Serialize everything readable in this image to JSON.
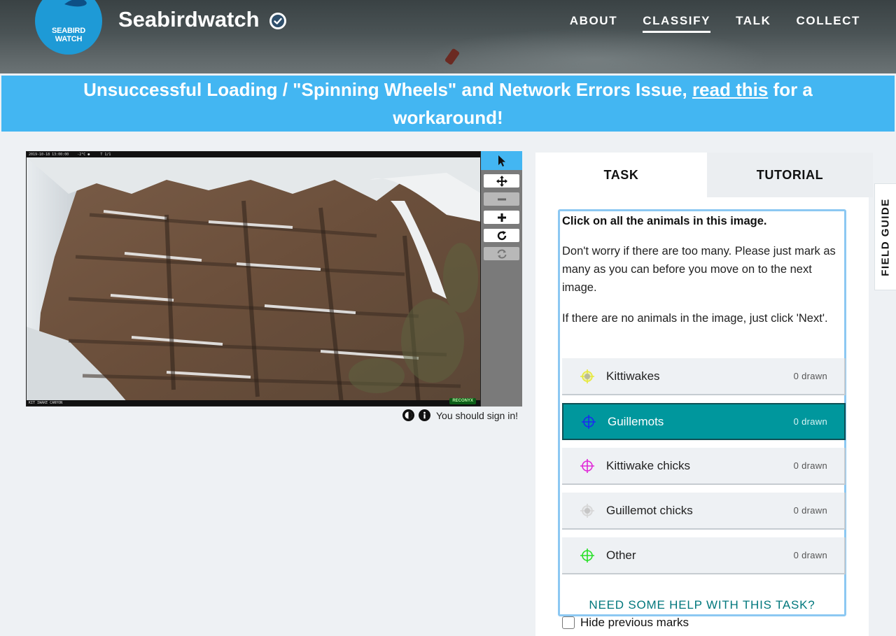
{
  "header": {
    "logo_text_line1": "SEABIRD",
    "logo_text_line2": "WATCH",
    "project_title": "Seabirdwatch",
    "nav": [
      {
        "label": "ABOUT",
        "active": false
      },
      {
        "label": "CLASSIFY",
        "active": true
      },
      {
        "label": "TALK",
        "active": false
      },
      {
        "label": "COLLECT",
        "active": false
      }
    ]
  },
  "banner": {
    "text_before": "Unsuccessful Loading / \"Spinning Wheels\" and Network Errors Issue, ",
    "link_text": "read this",
    "text_after": " for a workaround!"
  },
  "viewer": {
    "camera_top_text": "2019-10-18 13:00:00    -2°C ●     T 1/1",
    "camera_bottom_text": "KIT IWAKE CANYON",
    "camera_brand": "RECONYX",
    "sign_in_text": "You should sign in!",
    "tools": [
      "pointer-icon",
      "move-icon",
      "zoom-out-icon",
      "zoom-in-icon",
      "rotate-icon",
      "reset-icon"
    ]
  },
  "task_panel": {
    "tabs": [
      "TASK",
      "TUTORIAL"
    ],
    "question": "Click on all the animals in this image.",
    "instruction_1": "Don't worry if there are too many. Please just mark as many as you can before you move on to the next image.",
    "instruction_2": "If there are no animals in the image, just click 'Next'.",
    "answers": [
      {
        "label": "Kittiwakes",
        "count": "0 drawn",
        "color": "#e6e83a",
        "selected": false
      },
      {
        "label": "Guillemots",
        "count": "0 drawn",
        "color": "#1a2cf0",
        "selected": true
      },
      {
        "label": "Kittiwake chicks",
        "count": "0 drawn",
        "color": "#e02ad8",
        "selected": false
      },
      {
        "label": "Guillemot chicks",
        "count": "0 drawn",
        "color": "#d6d6d6",
        "selected": false
      },
      {
        "label": "Other",
        "count": "0 drawn",
        "color": "#26e026",
        "selected": false
      }
    ],
    "help_text": "NEED SOME HELP WITH THIS TASK?",
    "hide_previous_label": "Hide previous marks"
  },
  "field_guide": "FIELD GUIDE",
  "colors": {
    "banner_blue": "#43b6f2",
    "logo_blue": "#1e9ad6",
    "selected_teal": "#00979d",
    "task_border": "#8cc8f2"
  }
}
